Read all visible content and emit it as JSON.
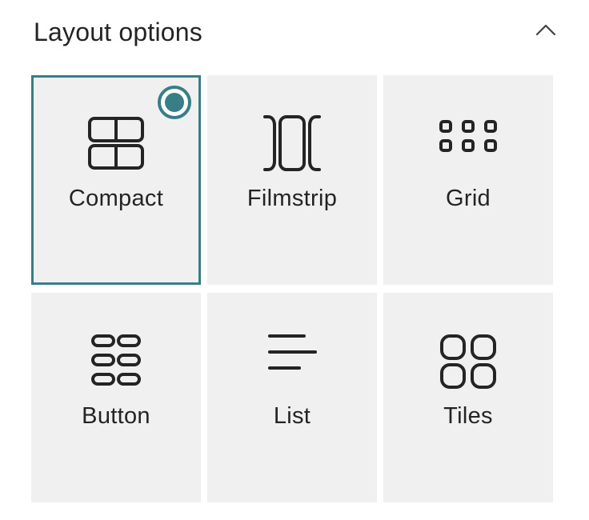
{
  "header": {
    "title": "Layout options",
    "collapse_icon": "chevron-up-icon"
  },
  "accent_color": "#377e86",
  "layouts": [
    {
      "label": "Compact",
      "icon": "compact-layout-icon",
      "selected": true
    },
    {
      "label": "Filmstrip",
      "icon": "filmstrip-layout-icon",
      "selected": false
    },
    {
      "label": "Grid",
      "icon": "grid-layout-icon",
      "selected": false
    },
    {
      "label": "Button",
      "icon": "button-layout-icon",
      "selected": false
    },
    {
      "label": "List",
      "icon": "list-layout-icon",
      "selected": false
    },
    {
      "label": "Tiles",
      "icon": "tiles-layout-icon",
      "selected": false
    }
  ]
}
